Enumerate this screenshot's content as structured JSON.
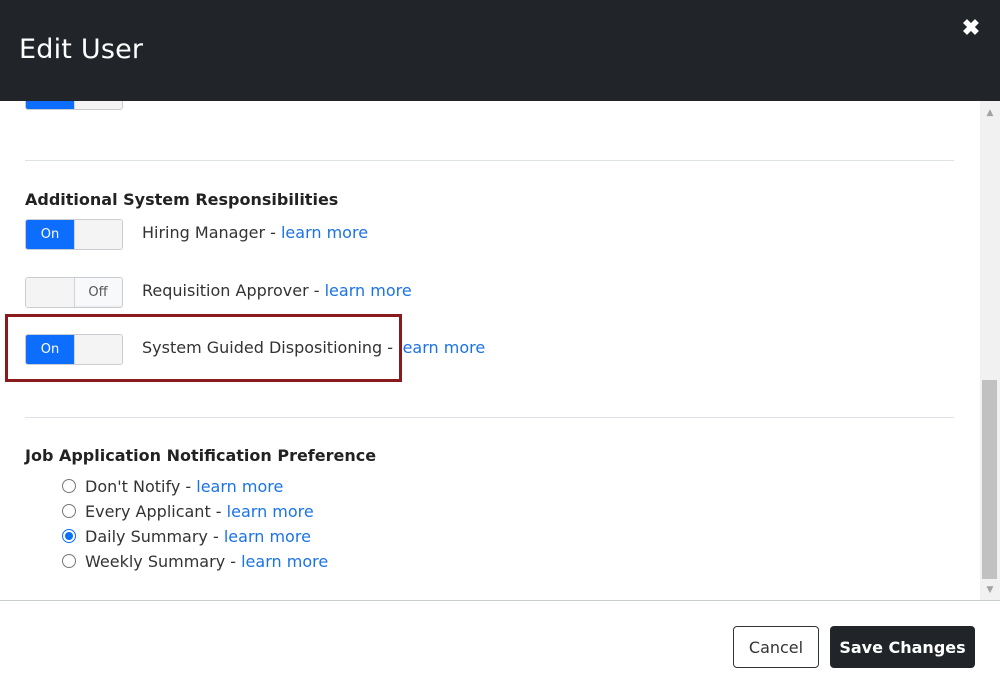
{
  "modal": {
    "title": "Edit User",
    "close_icon": "close-icon"
  },
  "sections": {
    "responsibilities": {
      "heading": "Additional System Responsibilities",
      "items": [
        {
          "state_label": "On",
          "label": "Hiring Manager - ",
          "link": "learn more",
          "state": "on"
        },
        {
          "state_label": "Off",
          "label": "Requisition Approver - ",
          "link": "learn more",
          "state": "off"
        },
        {
          "state_label": "On",
          "label": "System Guided Dispositioning - ",
          "link": "learn more",
          "state": "on"
        }
      ]
    },
    "notifications": {
      "heading": "Job Application Notification Preference",
      "options": [
        {
          "label": "Don't Notify - ",
          "link": "learn more",
          "checked": false
        },
        {
          "label": "Every Applicant - ",
          "link": "learn more",
          "checked": false
        },
        {
          "label": "Daily Summary - ",
          "link": "learn more",
          "checked": true
        },
        {
          "label": "Weekly Summary - ",
          "link": "learn more",
          "checked": false
        }
      ]
    }
  },
  "footer": {
    "cancel_label": "Cancel",
    "save_label": "Save Changes"
  },
  "colors": {
    "header_bg": "#212529",
    "toggle_on": "#0d6efd",
    "link": "#1a73e8",
    "highlight": "#8b1a1a"
  }
}
